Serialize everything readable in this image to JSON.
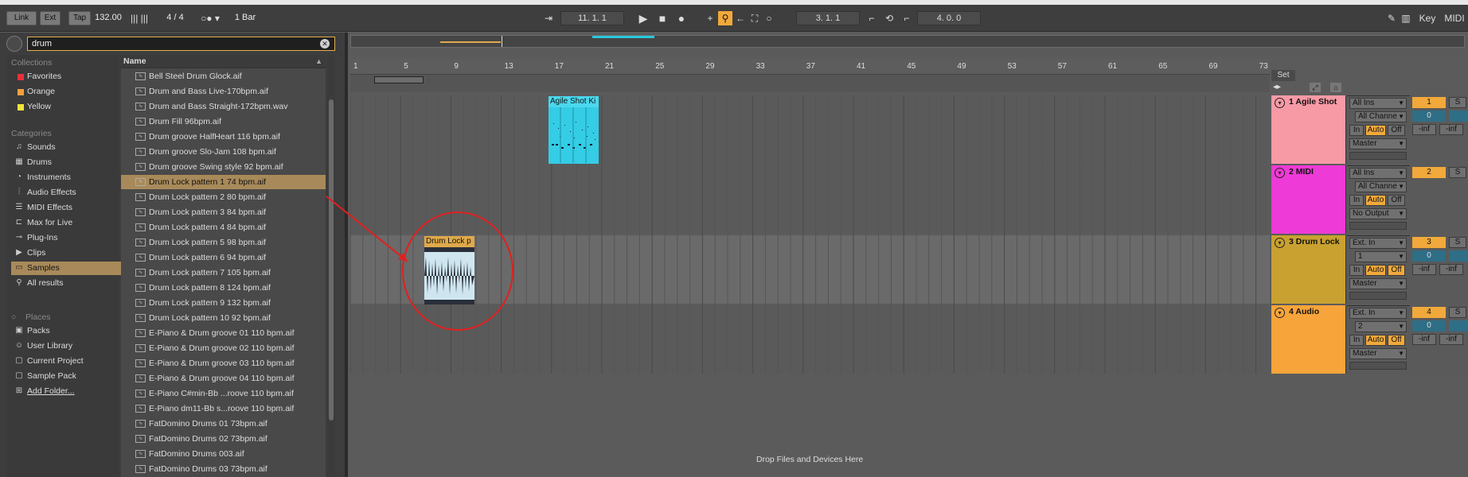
{
  "toolbar": {
    "link": "Link",
    "ext": "Ext",
    "tap": "Tap",
    "tempo": "132.00",
    "time_signature": "4 / 4",
    "quantize": "1 Bar",
    "position": "11.  1.  1",
    "loop_start": "3.  1.  1",
    "loop_length": "4.  0.  0",
    "key": "Key",
    "midi": "MIDI"
  },
  "browser": {
    "search_value": "drum",
    "collections_title": "Collections",
    "collections": [
      {
        "label": "Favorites",
        "color": "#e8303a"
      },
      {
        "label": "Orange",
        "color": "#f2a03b"
      },
      {
        "label": "Yellow",
        "color": "#f2e33b"
      }
    ],
    "categories_title": "Categories",
    "categories": [
      {
        "label": "Sounds",
        "icon": "sounds-icon"
      },
      {
        "label": "Drums",
        "icon": "drums-icon"
      },
      {
        "label": "Instruments",
        "icon": "instruments-icon"
      },
      {
        "label": "Audio Effects",
        "icon": "audio-effects-icon"
      },
      {
        "label": "MIDI Effects",
        "icon": "midi-effects-icon"
      },
      {
        "label": "Max for Live",
        "icon": "max-for-live-icon"
      },
      {
        "label": "Plug-Ins",
        "icon": "plug-ins-icon"
      },
      {
        "label": "Clips",
        "icon": "clips-icon"
      },
      {
        "label": "Samples",
        "icon": "samples-icon"
      },
      {
        "label": "All results",
        "icon": "search-icon"
      }
    ],
    "places_title": "Places",
    "places": [
      {
        "label": "Packs",
        "icon": "packs-icon"
      },
      {
        "label": "User Library",
        "icon": "user-library-icon"
      },
      {
        "label": "Current Project",
        "icon": "folder-icon"
      },
      {
        "label": "Sample Pack",
        "icon": "folder-icon"
      },
      {
        "label": "Add Folder...",
        "icon": "add-folder-icon"
      }
    ],
    "name_header": "Name",
    "files": [
      "Bell Steel Drum Glock.aif",
      "Drum and Bass Live-170bpm.aif",
      "Drum and Bass Straight-172bpm.wav",
      "Drum Fill 96bpm.aif",
      "Drum groove HalfHeart 116 bpm.aif",
      "Drum groove Slo-Jam 108 bpm.aif",
      "Drum groove Swing style 92 bpm.aif",
      "Drum Lock pattern 1 74 bpm.aif",
      "Drum Lock pattern 2 80 bpm.aif",
      "Drum Lock pattern 3 84 bpm.aif",
      "Drum Lock pattern 4 84 bpm.aif",
      "Drum Lock pattern 5 98 bpm.aif",
      "Drum Lock pattern 6 94 bpm.aif",
      "Drum Lock pattern 7 105 bpm.aif",
      "Drum Lock pattern 8 124 bpm.aif",
      "Drum Lock pattern 9 132 bpm.aif",
      "Drum Lock pattern 10 92 bpm.aif",
      "E-Piano & Drum groove 01 110 bpm.aif",
      "E-Piano & Drum groove 02 110 bpm.aif",
      "E-Piano & Drum groove 03 110 bpm.aif",
      "E-Piano & Drum groove 04 110 bpm.aif",
      "E-Piano C#min-Bb ...roove 110 bpm.aif",
      "E-Piano dm11-Bb s...roove 110 bpm.aif",
      "FatDomino Drums 01 73bpm.aif",
      "FatDomino Drums 02 73bpm.aif",
      "FatDomino Drums 003.aif",
      "FatDomino Drums 03 73bpm.aif"
    ]
  },
  "arrangement": {
    "ruler": [
      "1",
      "5",
      "9",
      "13",
      "17",
      "21",
      "25",
      "29",
      "33",
      "37",
      "41",
      "45",
      "49",
      "53",
      "57",
      "61",
      "65",
      "69",
      "73"
    ],
    "set_label": "Set",
    "drop_hint": "Drop Files and Devices Here",
    "clips": {
      "midi_clip": "Agile Shot Ki",
      "audio_clip": "Drum Lock p"
    }
  },
  "tracks": [
    {
      "name": "1 Agile Shot",
      "color": "#f79aa6",
      "input": "All Ins",
      "channel": "All Channe",
      "auto": "Auto",
      "off": "Off",
      "in": "In",
      "output": "Master",
      "number": "1",
      "volume": "0",
      "inf_l": "-inf",
      "inf_r": "-inf",
      "solo": "S"
    },
    {
      "name": "2 MIDI",
      "color": "#ee3ad6",
      "input": "All Ins",
      "channel": "All Channe",
      "auto": "Auto",
      "off": "Off",
      "in": "In",
      "output": "No Output",
      "number": "2",
      "volume": "",
      "inf_l": "",
      "inf_r": "",
      "solo": "S"
    },
    {
      "name": "3 Drum Lock",
      "color": "#c9a130",
      "input": "Ext. In",
      "channel": "1",
      "auto": "Auto",
      "off": "Off",
      "in": "In",
      "output": "Master",
      "number": "3",
      "volume": "0",
      "inf_l": "-inf",
      "inf_r": "-inf",
      "solo": "S"
    },
    {
      "name": "4 Audio",
      "color": "#f7a43a",
      "input": "Ext. In",
      "channel": "2",
      "auto": "Auto",
      "off": "Off",
      "in": "In",
      "output": "Master",
      "number": "4",
      "volume": "0",
      "inf_l": "-inf",
      "inf_r": "-inf",
      "solo": "S"
    }
  ]
}
